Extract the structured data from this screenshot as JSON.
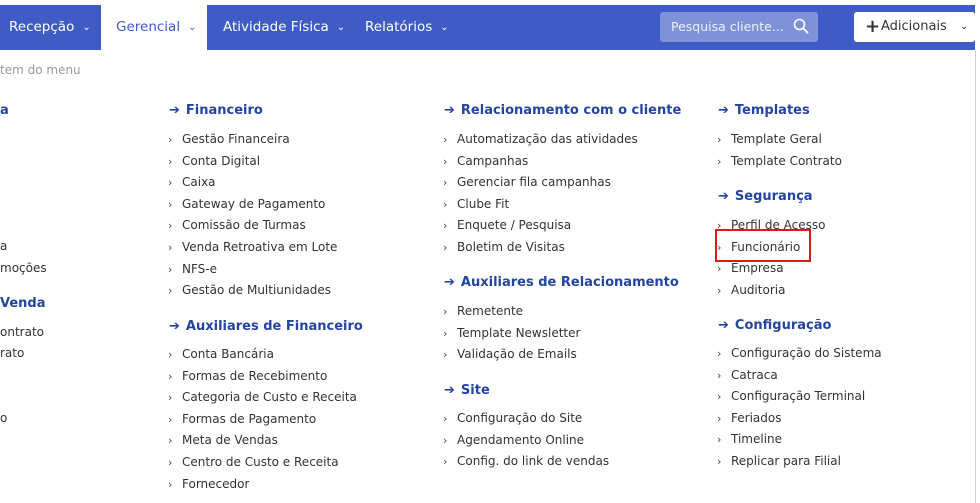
{
  "nav": {
    "items": [
      "Recepção",
      "Gerencial",
      "Atividade Física",
      "Relatórios"
    ],
    "active": "Gerencial",
    "search_placeholder": "Pesquisa cliente...",
    "add_label": "Adicionais"
  },
  "hint": "tem do menu",
  "left_partial": {
    "title_1": "a",
    "items_1": [
      "a",
      "moções"
    ],
    "title_2": "Venda",
    "items_2": [
      "ontrato",
      "rato",
      "o"
    ]
  },
  "financeiro": {
    "title": "Financeiro",
    "items": [
      "Gestão Financeira",
      "Conta Digital",
      "Caixa",
      "Gateway de Pagamento",
      "Comissão de Turmas",
      "Venda Retroativa em Lote",
      "NFS-e",
      "Gestão de Multiunidades"
    ]
  },
  "aux_financeiro": {
    "title": "Auxiliares de Financeiro",
    "items": [
      "Conta Bancária",
      "Formas de Recebimento",
      "Categoria de Custo e Receita",
      "Formas de Pagamento",
      "Meta de Vendas",
      "Centro de Custo e Receita",
      "Fornecedor"
    ]
  },
  "relacionamento": {
    "title": "Relacionamento com o cliente",
    "items": [
      "Automatização das atividades",
      "Campanhas",
      "Gerenciar fila campanhas",
      "Clube Fit",
      "Enquete / Pesquisa",
      "Boletim de Visitas"
    ]
  },
  "aux_relacionamento": {
    "title": "Auxiliares de Relacionamento",
    "items": [
      "Remetente",
      "Template Newsletter",
      "Validação de Emails"
    ]
  },
  "site": {
    "title": "Site",
    "items": [
      "Configuração do Site",
      "Agendamento Online",
      "Config. do link de vendas"
    ]
  },
  "templates": {
    "title": "Templates",
    "items": [
      "Template Geral",
      "Template Contrato"
    ]
  },
  "seguranca": {
    "title": "Segurança",
    "items": [
      "Perfil de Acesso",
      "Funcionário",
      "Empresa",
      "Auditoria"
    ]
  },
  "configuracao": {
    "title": "Configuração",
    "items": [
      "Configuração do Sistema",
      "Catraca",
      "Configuração Terminal",
      "Feriados",
      "Timeline",
      "Replicar para Filial"
    ]
  },
  "colors": {
    "nav": "#3f5bc5",
    "section_title": "#2345a0",
    "highlight": "#e01818"
  }
}
